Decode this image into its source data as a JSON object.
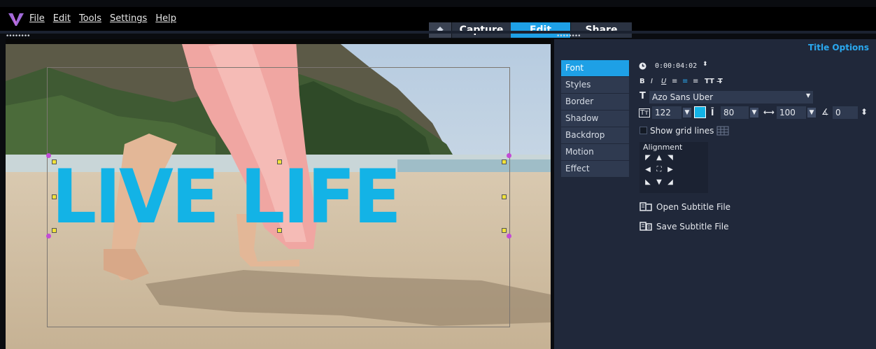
{
  "menubar": {
    "menus": [
      "File",
      "Edit",
      "Tools",
      "Settings",
      "Help"
    ]
  },
  "tabs": {
    "home_icon": "home-icon",
    "items": [
      "Capture",
      "Edit",
      "Share"
    ],
    "active": "Edit"
  },
  "preview": {
    "title_text": "LIVE LIFE"
  },
  "panel": {
    "title": "Title Options",
    "side_tabs": [
      "Font",
      "Styles",
      "Border",
      "Shadow",
      "Backdrop",
      "Motion",
      "Effect"
    ],
    "active_side_tab": "Font",
    "duration": "0:00:04:02",
    "format_buttons": [
      "B",
      "I",
      "U",
      "≡",
      "≡",
      "≡",
      "TT",
      "T̶"
    ],
    "font_name": "Azo Sans Uber",
    "font_size": "122",
    "line_spacing": "80",
    "char_spacing": "100",
    "angle": "0",
    "show_grid_label": "Show grid lines",
    "alignment_label": "Alignment",
    "open_subtitle": "Open Subtitle File",
    "save_subtitle": "Save Subtitle File",
    "text_color": "#13b3e6",
    "accent": "#1ea0e6"
  }
}
